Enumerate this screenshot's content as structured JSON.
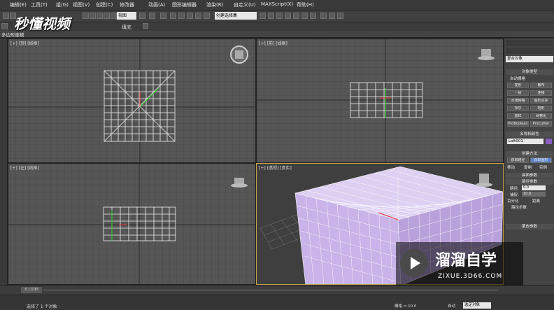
{
  "menu": [
    "编辑(E)",
    "工具(T)",
    "组(G)",
    "视图(V)",
    "创建(C)",
    "修改器",
    "动画(A)",
    "图形编辑器",
    "渲染(R)",
    "自定义(U)",
    "MAXScript(X)",
    "帮助(H)"
  ],
  "toolbar": {
    "view_dropdown": "视图",
    "selection_set": "创建选择集"
  },
  "ribbon": {
    "left_label": "多边形建模",
    "fill_label": "填充"
  },
  "logo_text": "秒懂视频",
  "viewports": {
    "top": "[+] [顶] [线框]",
    "front": "[+] [前] [线框]",
    "left": "[+] [左] [线框]",
    "perspective": "[+] [透视] [真实]"
  },
  "command_panel": {
    "category": "复合对象",
    "object_type": "对象类型",
    "auto_grid": "自动栅格",
    "buttons": [
      "变形",
      "散布",
      "一致",
      "连接",
      "水滴网格",
      "图形合并",
      "布尔",
      "地形",
      "放样",
      "网格化",
      "ProBoolean",
      "ProCutter"
    ],
    "name_color": "名称和颜色",
    "object_name": "Loft001",
    "creation_method": "创建方法",
    "get_path": "获取路径",
    "get_shape": "获取图形",
    "move": "移动",
    "copy": "复制",
    "instance": "实例",
    "surface_params": "曲面参数",
    "path_params": "路径参数",
    "path_label": "路径:",
    "path_value": "0.0",
    "snap_label": "捕捉:",
    "snap_value": "10.0",
    "percent": "百分比",
    "distance": "距离",
    "path_steps": "路径步数",
    "skin_params": "蒙皮参数"
  },
  "timeline": {
    "frame": "0 / 100"
  },
  "status": {
    "selected": "选择了 1 个对象",
    "grid": "栅格 = 10.0",
    "auto": "自动",
    "selected_obj": "选定对象"
  },
  "watermark": {
    "title": "溜溜自学",
    "url": "ZIXUE.3D66.COM"
  },
  "colors": {
    "object_fill": "#c9b3e8",
    "viewport_bg": "#565656",
    "active_border": "#c8a54a"
  }
}
